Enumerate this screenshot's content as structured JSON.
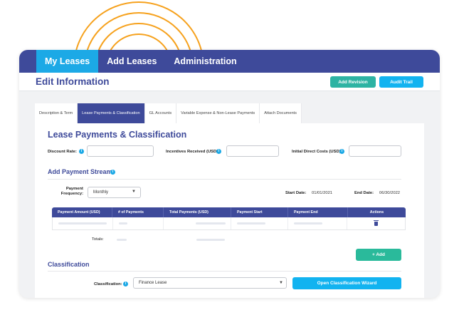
{
  "nav": {
    "tabs": [
      "My Leases",
      "Add Leases",
      "Administration"
    ],
    "active": 0
  },
  "header": {
    "title": "Edit Information",
    "add_revision": "Add Revision",
    "audit_trail": "Audit Trail"
  },
  "tabs": [
    "Description & Term",
    "Lease Payments & Classification",
    "GL Accounts",
    "Variable Expense & Non-Lease Payments",
    "Attach Documents"
  ],
  "section": {
    "title": "Lease Payments & Classification",
    "discount_rate_label": "Discount Rate:",
    "incentives_label": "Incentives Received (USD)",
    "idc_label": "Initial Direct Costs (USD)"
  },
  "stream": {
    "title": "Add Payment Stream",
    "frequency_label": "Payment Frequency:",
    "frequency_value": "Monthly",
    "start_label": "Start Date:",
    "start_value": "01/01/2021",
    "end_label": "End Date:",
    "end_value": "06/30/2022"
  },
  "table": {
    "columns": [
      "Payment Amount (USD)",
      "# of Payments",
      "Total Payments (USD)",
      "Payment Start",
      "Payment End",
      "Actions"
    ],
    "totals_label": "Totals:"
  },
  "add_button": "+ Add",
  "classification": {
    "title": "Classification",
    "label": "Classification:",
    "value": "Finance Lease",
    "wizard_button": "Open Classification Wizard"
  },
  "colors": {
    "primary": "#3e4a9a",
    "accent": "#1ca9e6",
    "teal": "#2db3a3",
    "arcs": "#f6a11c"
  }
}
